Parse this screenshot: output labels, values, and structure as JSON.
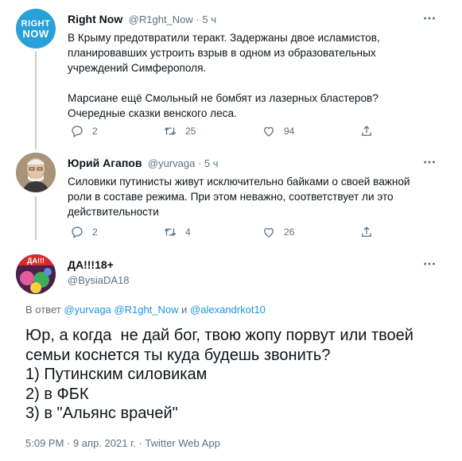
{
  "tweet1": {
    "name": "Right Now",
    "meta": "@R1ght_Now · 5 ч",
    "avatar_text_1": "RIGHT",
    "avatar_text_2": "NOW",
    "body_lines": [
      "В Крыму предотвратили теракт. Задержаны двое исламистов,",
      "планировавших устроить взрыв в одном из образовательных",
      "учреждений Симферополя.",
      "",
      "Марсиане ещё Смольный не бомбят из лазерных бластеров?",
      "Очередные сказки венского леса."
    ],
    "replies": "2",
    "retweets": "25",
    "likes": "94"
  },
  "tweet2": {
    "name": "Юрий Агапов",
    "meta": "@yurvaga · 5 ч",
    "body_lines": [
      "Силовики путинисты живут исключительно байками о своей важной",
      "роли в составе режима. При этом неважно, соответствует ли это",
      "действительности"
    ],
    "replies": "2",
    "retweets": "4",
    "likes": "26"
  },
  "tweet3": {
    "name": "ДА!!!18+",
    "handle": "@BysiaDA18",
    "reply_prefix": "В ответ",
    "reply_users": [
      "@yurvaga",
      "@R1ght_Now",
      "и",
      "@alexandrkot10"
    ],
    "body_lines": [
      "Юр, а когда  не дай бог, твою жопу порвут или твоей",
      "семьи коснется ты куда будешь звонить?",
      "1) Путинским силовикам",
      "2) в ФБК",
      "3) в \"Альянс врачей\""
    ],
    "timestamp": "5:09 PM · 9 апр. 2021 г. · Twitter Web App"
  },
  "colors": {
    "muted": "#5b7083",
    "link": "#1b95e0",
    "avatar_brand": "#28a0d8"
  }
}
